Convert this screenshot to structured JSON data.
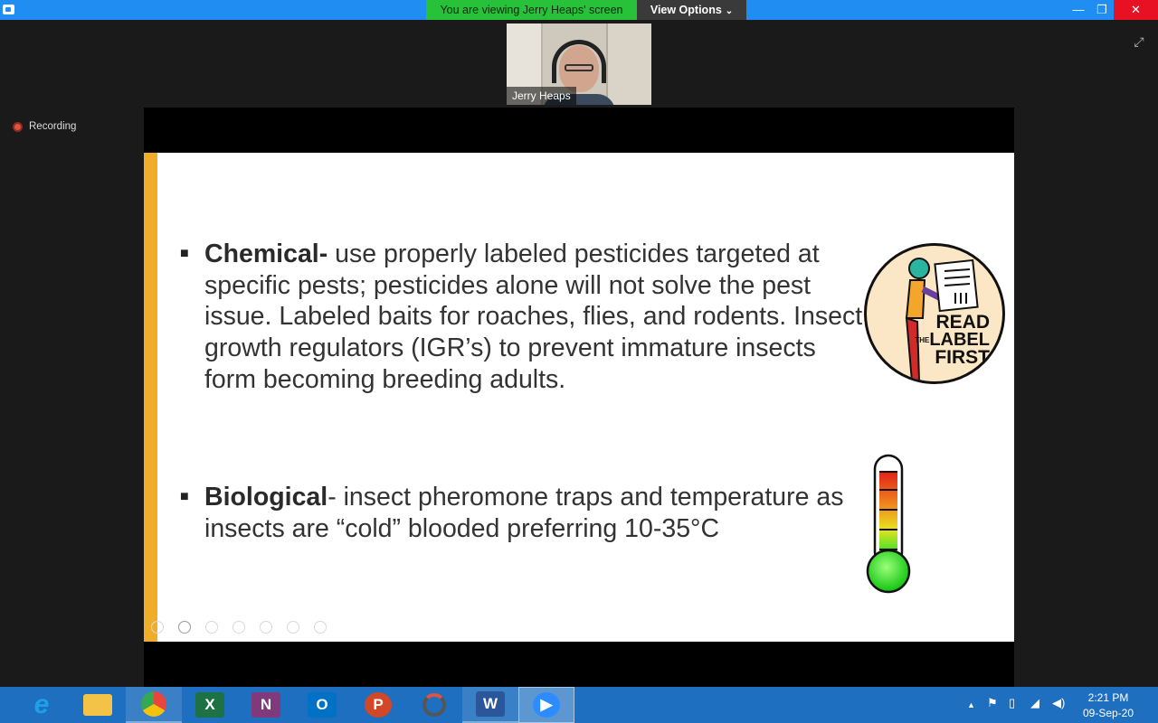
{
  "titlebar": {
    "viewing_text": "You are viewing Jerry Heaps' screen",
    "view_options_label": "View Options",
    "minimize_glyph": "—",
    "restore_glyph": "❐",
    "close_glyph": "✕"
  },
  "video": {
    "participant_name": "Jerry Heaps"
  },
  "recording": {
    "label": "Recording"
  },
  "slide": {
    "bullets": [
      {
        "term": "Chemical-",
        "text": " use properly labeled pesticides targeted at specific pests; pesticides alone will not solve the pest issue. Labeled baits for roaches, flies, and rodents. Insect growth regulators (IGR’s) to prevent immature insects form becoming breeding adults."
      },
      {
        "term": "Biological",
        "text": "- insect pheromone traps and temperature as insects are “cold” blooded preferring 10-35°C"
      }
    ],
    "badge": {
      "line1": "READ",
      "line2": "LABEL",
      "line3": "FIRST",
      "small_word": "THE"
    },
    "accent_color": "#f0ad2a"
  },
  "taskbar": {
    "apps": [
      {
        "name": "Internet Explorer",
        "letter": "e",
        "color": "#1ea0e8"
      },
      {
        "name": "File Explorer",
        "letter": "",
        "color": "#f3c348"
      },
      {
        "name": "Google Chrome",
        "letter": "",
        "color": "#e8453c"
      },
      {
        "name": "Excel",
        "letter": "X",
        "color": "#1e7145"
      },
      {
        "name": "OneNote",
        "letter": "N",
        "color": "#80397b"
      },
      {
        "name": "Outlook",
        "letter": "O",
        "color": "#0072c6"
      },
      {
        "name": "PowerPoint",
        "letter": "P",
        "color": "#d24726"
      },
      {
        "name": "Sync",
        "letter": "",
        "color": "#555"
      },
      {
        "name": "Word",
        "letter": "W",
        "color": "#2b579a"
      },
      {
        "name": "Zoom",
        "letter": "",
        "color": "#2d8cff"
      }
    ],
    "time": "2:21 PM",
    "date": "09-Sep-20"
  }
}
